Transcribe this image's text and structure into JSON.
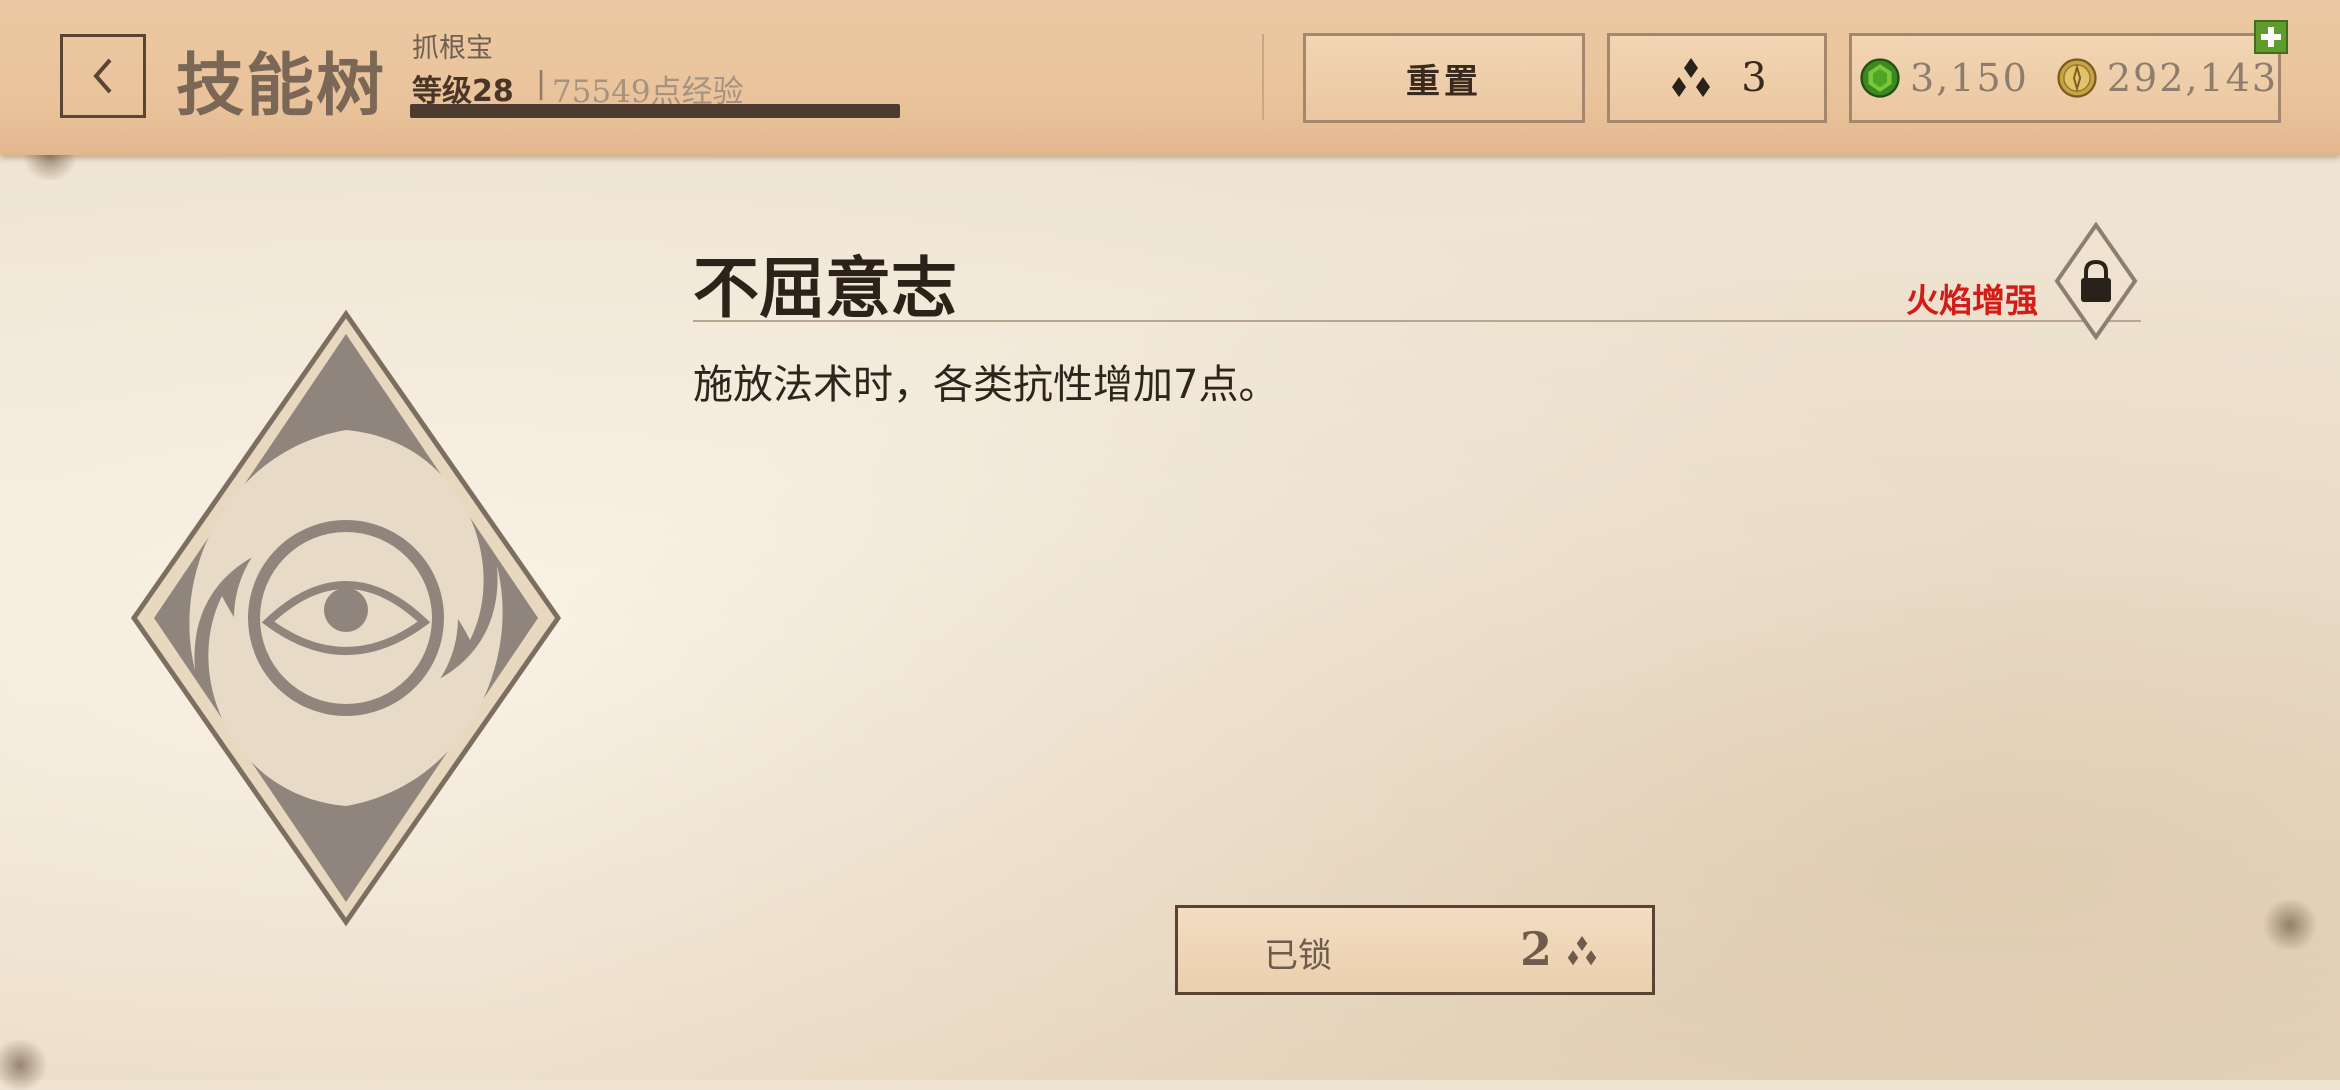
{
  "header": {
    "back_icon": "chevron-left-icon",
    "title": "技能树",
    "player_name": "抓根宝",
    "level_text": "等级28",
    "separator": "|",
    "xp_text": "75549点经验",
    "xp_progress": 1.0,
    "reset_label": "重置",
    "skill_points_icon": "skill-points-icon",
    "skill_points": "3",
    "gem_icon": "green-gem-icon",
    "gems": "3,150",
    "gold_icon": "gold-coin-icon",
    "gold": "292,143",
    "add_icon": "plus-icon"
  },
  "skill": {
    "icon": "eye-spiral-icon",
    "name": "不屈意志",
    "requirement": "火焰增强",
    "requirement_icon": "lock-icon",
    "description": "施放法术时，各类抗性增加7点。",
    "action_label": "已锁",
    "cost": "2",
    "cost_icon": "skill-points-icon"
  },
  "colors": {
    "requirement_red": "#d31c18",
    "plus_green": "#5f9b2d"
  }
}
